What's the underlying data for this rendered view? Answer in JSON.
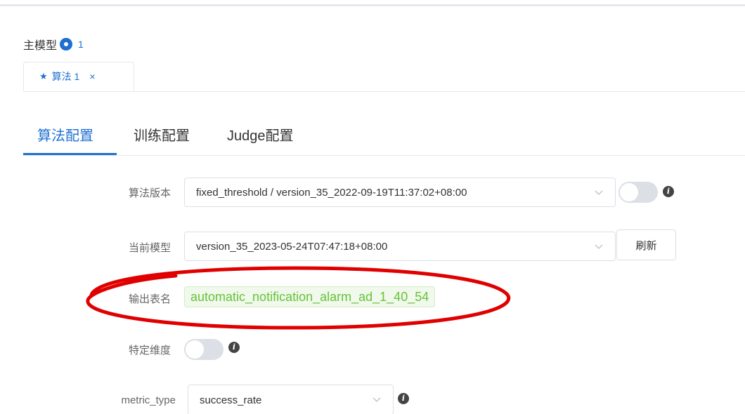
{
  "main_model": {
    "title": "主模型",
    "count": "1"
  },
  "algo_tabs": [
    {
      "label": "算法 1",
      "close": "×"
    }
  ],
  "config_tabs": [
    {
      "label": "算法配置",
      "active": true
    },
    {
      "label": "训练配置",
      "active": false
    },
    {
      "label": "Judge配置",
      "active": false
    }
  ],
  "form": {
    "algo_version": {
      "label": "算法版本",
      "value": "fixed_threshold / version_35_2022-09-19T11:37:02+08:00"
    },
    "current_model": {
      "label": "当前模型",
      "value": "version_35_2023-05-24T07:47:18+08:00",
      "refresh_label": "刷新"
    },
    "output_table": {
      "label": "输出表名",
      "value": "automatic_notification_alarm_ad_1_40_54"
    },
    "specific_dimension": {
      "label": "特定维度"
    },
    "metric_type": {
      "label": "metric_type",
      "value": "success_rate"
    }
  },
  "colors": {
    "primary": "#1f6fd0",
    "tag_green": "#67c23a",
    "annotation_red": "#e00000"
  }
}
